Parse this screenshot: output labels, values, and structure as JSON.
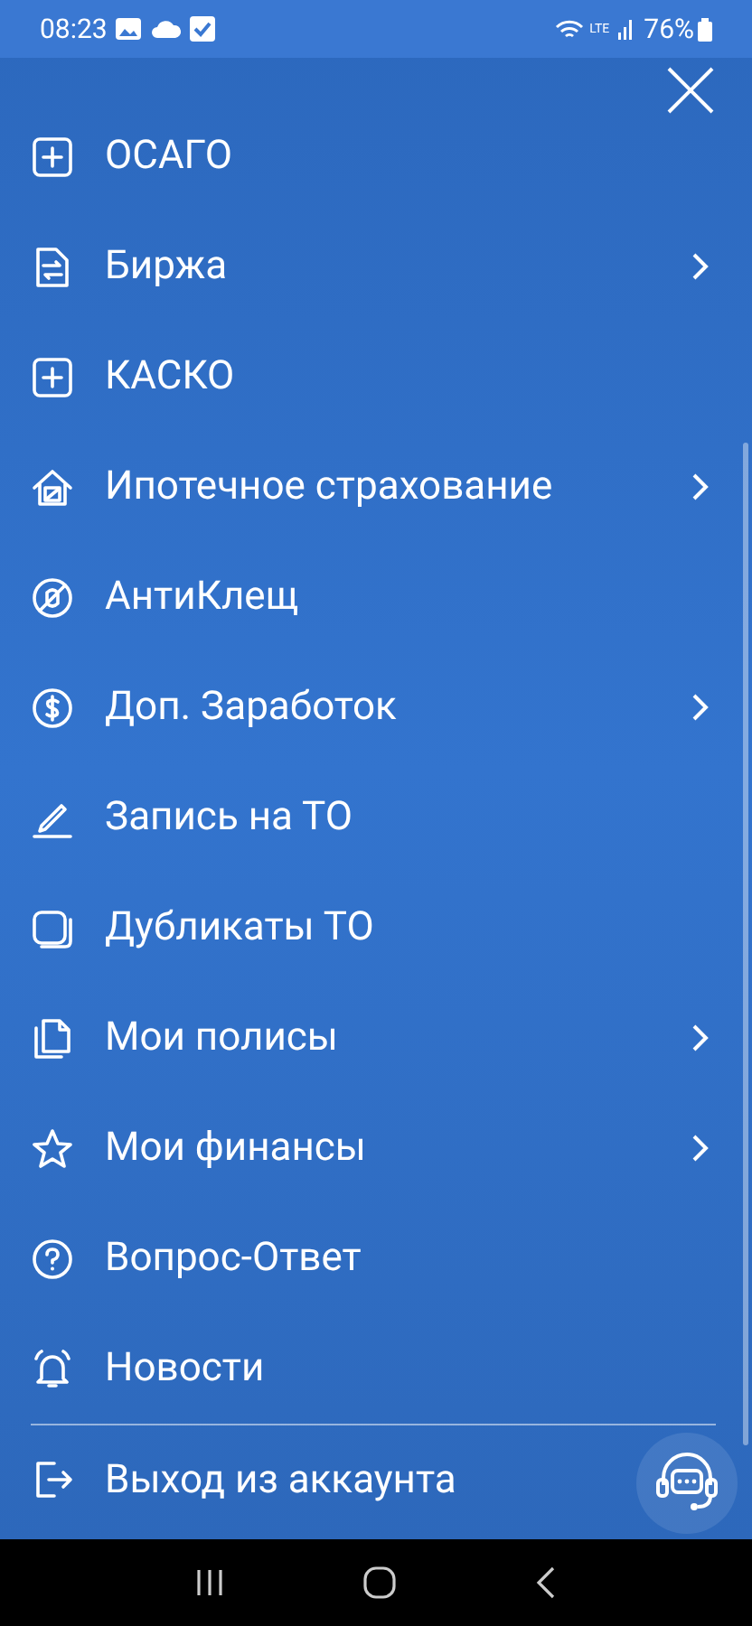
{
  "status_bar": {
    "time": "08:23",
    "battery": "76%",
    "network": "LTE"
  },
  "menu": {
    "items": [
      {
        "label": "ОСАГО",
        "has_submenu": false
      },
      {
        "label": "Биржа",
        "has_submenu": true
      },
      {
        "label": "КАСКО",
        "has_submenu": false
      },
      {
        "label": "Ипотечное страхование",
        "has_submenu": true
      },
      {
        "label": "АнтиКлещ",
        "has_submenu": false
      },
      {
        "label": "Доп. Заработок",
        "has_submenu": true
      },
      {
        "label": "Запись на ТО",
        "has_submenu": false
      },
      {
        "label": "Дубликаты ТО",
        "has_submenu": false
      },
      {
        "label": "Мои полисы",
        "has_submenu": true
      },
      {
        "label": "Мои финансы",
        "has_submenu": true
      },
      {
        "label": "Вопрос-Ответ",
        "has_submenu": false
      },
      {
        "label": "Новости",
        "has_submenu": false
      },
      {
        "label": "Выход из аккаунта",
        "has_submenu": false
      }
    ]
  }
}
